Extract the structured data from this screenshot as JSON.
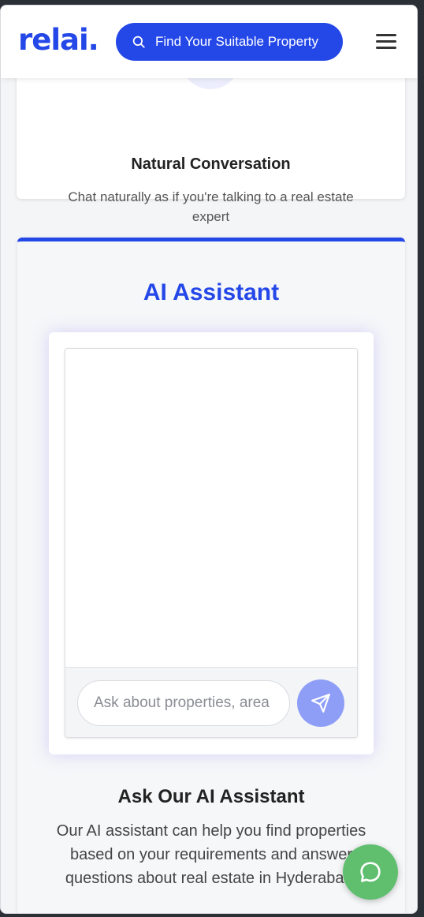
{
  "header": {
    "logo": "relai.",
    "search_button_label": "Find Your Suitable Property",
    "menu_icon": "hamburger-menu-icon"
  },
  "feature_card": {
    "title": "Natural Conversation",
    "description": "Chat naturally as if you're talking to a real estate expert"
  },
  "assistant": {
    "title": "AI Assistant",
    "input_placeholder": "Ask about properties, area",
    "send_icon": "send-icon",
    "heading": "Ask Our AI Assistant",
    "description": "Our AI assistant can help you find properties based on your requirements and answer questions about real estate in Hyderabad."
  },
  "fab": {
    "icon": "chat-bubble-icon"
  },
  "colors": {
    "brand": "#2447e8",
    "send_button": "#8e9ef7",
    "fab": "#5fbf6e"
  }
}
